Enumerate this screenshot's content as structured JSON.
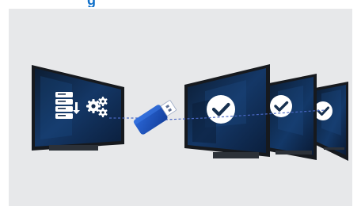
{
  "heading": {
    "text": "g"
  },
  "colors": {
    "heading": "#0e6fc9",
    "panel": "#e7e8ea",
    "tv_frame": "#16191e",
    "tv_screen": "#0f2d55",
    "usb_body": "#1c56c7",
    "connector_line": "#4a67c2",
    "checkmark_badge": "#ffffff",
    "checkmark": "#17304f"
  },
  "illustration": {
    "source_tv": {
      "icons": [
        "file-stack-icon",
        "arrow-icon",
        "gears-icon"
      ]
    },
    "usb_drive": {
      "icon": "usb-drive-icon"
    },
    "target_tvs": [
      {
        "icon": "checkmark-icon"
      },
      {
        "icon": "checkmark-icon"
      },
      {
        "icon": "checkmark-icon"
      }
    ]
  }
}
